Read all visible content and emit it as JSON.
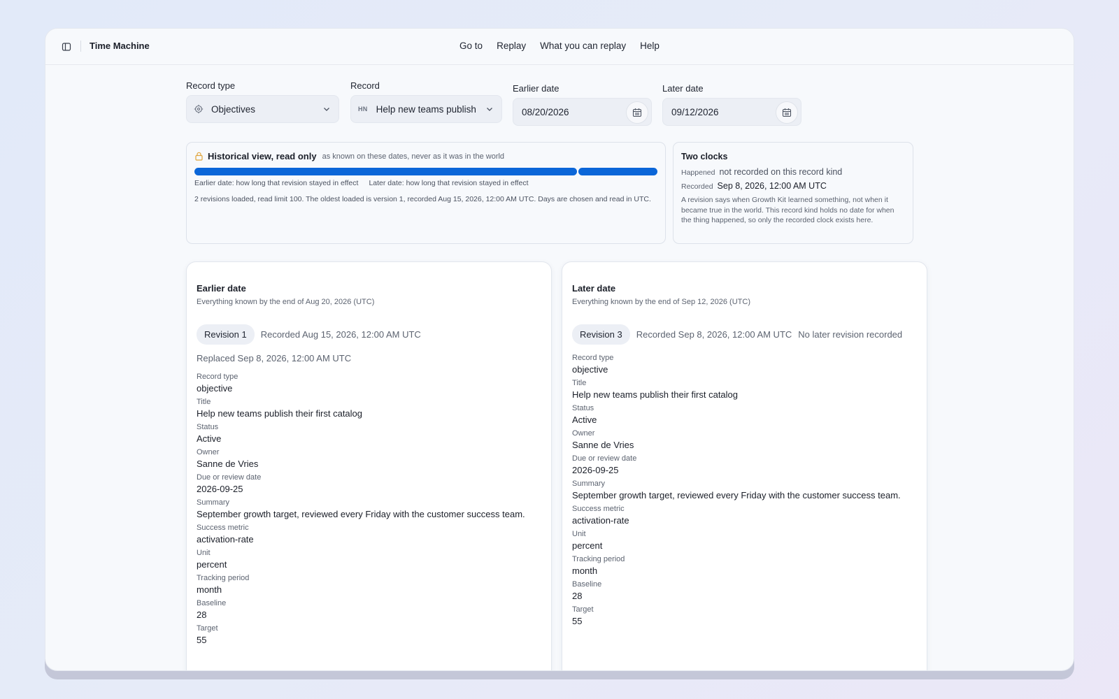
{
  "app": {
    "title": "Time Machine"
  },
  "nav": {
    "items": [
      "Go to",
      "Replay",
      "What you can replay",
      "Help"
    ]
  },
  "controls": {
    "record_type": {
      "label": "Record type",
      "value": "Objectives"
    },
    "record": {
      "label": "Record",
      "initials": "HN",
      "value": "Help new teams publish"
    },
    "earlier_date": {
      "label": "Earlier date",
      "value": "08/20/2026"
    },
    "later_date": {
      "label": "Later date",
      "value": "09/12/2026"
    }
  },
  "historical": {
    "title": "Historical view, read only",
    "subtitle": "as known on these dates, never as it was in the world",
    "bar": {
      "earlier_share": 0.83,
      "later_share": 0.17,
      "color": "#0b66d8"
    },
    "legend_earlier": "Earlier date: how long that revision stayed in effect",
    "legend_later": "Later date: how long that revision stayed in effect",
    "note": "2 revisions loaded, read limit 100. The oldest loaded is version 1, recorded Aug 15, 2026, 12:00 AM UTC. Days are chosen and read in UTC."
  },
  "clocks": {
    "title": "Two clocks",
    "happened_label": "Happened",
    "happened_value": "not recorded on this record kind",
    "recorded_label": "Recorded",
    "recorded_value": "Sep 8, 2026, 12:00 AM UTC",
    "note": "A revision says when Growth Kit learned something, not when it became true in the world. This record kind holds no date for when the thing happened, so only the recorded clock exists here."
  },
  "earlier": {
    "title": "Earlier date",
    "subtitle": "Everything known by the end of Aug 20, 2026 (UTC)",
    "revision": "Revision 1",
    "recorded": "Recorded Aug 15, 2026, 12:00 AM UTC",
    "replaced": "Replaced Sep 8, 2026, 12:00 AM UTC",
    "fields": [
      {
        "k": "Record type",
        "v": "objective"
      },
      {
        "k": "Title",
        "v": "Help new teams publish their first catalog"
      },
      {
        "k": "Status",
        "v": "Active"
      },
      {
        "k": "Owner",
        "v": "Sanne de Vries"
      },
      {
        "k": "Due or review date",
        "v": "2026-09-25"
      },
      {
        "k": "Summary",
        "v": "September growth target, reviewed every Friday with the customer success team."
      },
      {
        "k": "Success metric",
        "v": "activation-rate"
      },
      {
        "k": "Unit",
        "v": "percent"
      },
      {
        "k": "Tracking period",
        "v": "month"
      },
      {
        "k": "Baseline",
        "v": "28"
      },
      {
        "k": "Target",
        "v": "55"
      }
    ]
  },
  "later": {
    "title": "Later date",
    "subtitle": "Everything known by the end of Sep 12, 2026 (UTC)",
    "revision": "Revision 3",
    "recorded": "Recorded Sep 8, 2026, 12:00 AM UTC",
    "no_later": "No later revision recorded",
    "fields": [
      {
        "k": "Record type",
        "v": "objective"
      },
      {
        "k": "Title",
        "v": "Help new teams publish their first catalog"
      },
      {
        "k": "Status",
        "v": "Active"
      },
      {
        "k": "Owner",
        "v": "Sanne de Vries"
      },
      {
        "k": "Due or review date",
        "v": "2026-09-25"
      },
      {
        "k": "Summary",
        "v": "September growth target, reviewed every Friday with the customer success team."
      },
      {
        "k": "Success metric",
        "v": "activation-rate"
      },
      {
        "k": "Unit",
        "v": "percent"
      },
      {
        "k": "Tracking period",
        "v": "month"
      },
      {
        "k": "Baseline",
        "v": "28"
      },
      {
        "k": "Target",
        "v": "55"
      }
    ]
  }
}
